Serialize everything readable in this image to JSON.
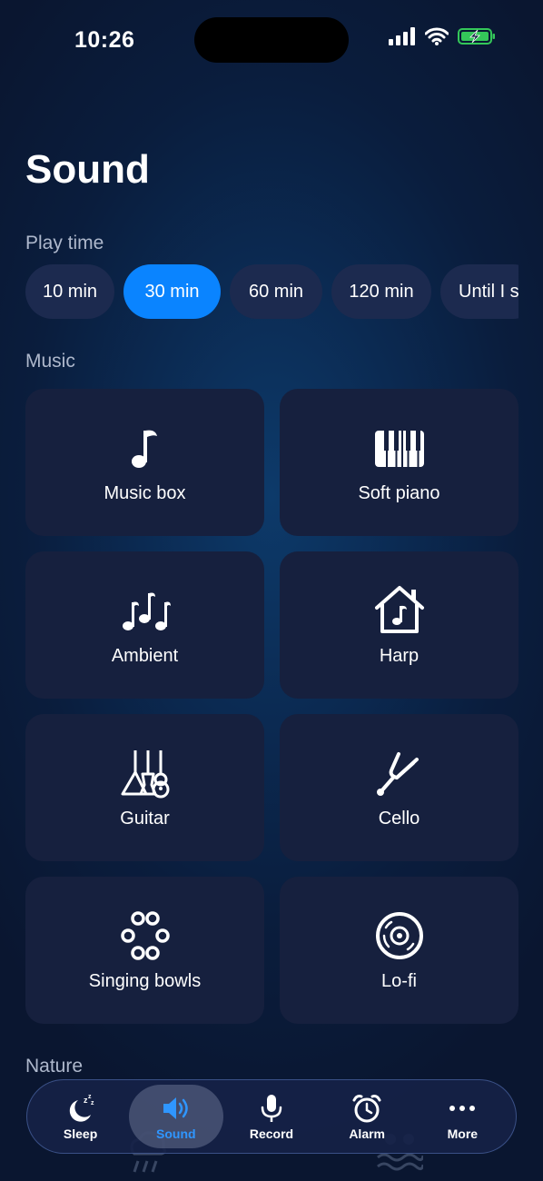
{
  "status_bar": {
    "time": "10:26"
  },
  "header": {
    "title": "Sound"
  },
  "play_time": {
    "label": "Play time",
    "options": [
      "10 min",
      "30 min",
      "60 min",
      "120 min",
      "Until I s"
    ],
    "selected": "30 min"
  },
  "music": {
    "label": "Music",
    "items": [
      {
        "label": "Music box",
        "icon": "music-note-icon"
      },
      {
        "label": "Soft piano",
        "icon": "piano-keys-icon"
      },
      {
        "label": "Ambient",
        "icon": "music-notes-icon"
      },
      {
        "label": "Harp",
        "icon": "music-house-icon"
      },
      {
        "label": "Guitar",
        "icon": "guitars-icon"
      },
      {
        "label": "Cello",
        "icon": "tuning-fork-icon"
      },
      {
        "label": "Singing bowls",
        "icon": "bowls-icon"
      },
      {
        "label": "Lo-fi",
        "icon": "vinyl-disc-icon"
      }
    ]
  },
  "nature": {
    "label": "Nature"
  },
  "tabbar": {
    "tabs": [
      {
        "label": "Sleep",
        "icon": "moon-zzz-icon"
      },
      {
        "label": "Sound",
        "icon": "speaker-icon"
      },
      {
        "label": "Record",
        "icon": "microphone-icon"
      },
      {
        "label": "Alarm",
        "icon": "alarm-clock-icon"
      },
      {
        "label": "More",
        "icon": "ellipsis-icon"
      }
    ],
    "active": "Sound"
  },
  "colors": {
    "accent": "#0a84ff",
    "tile": "#16203e",
    "chip": "#1c2a4f",
    "battery": "#34c759"
  }
}
